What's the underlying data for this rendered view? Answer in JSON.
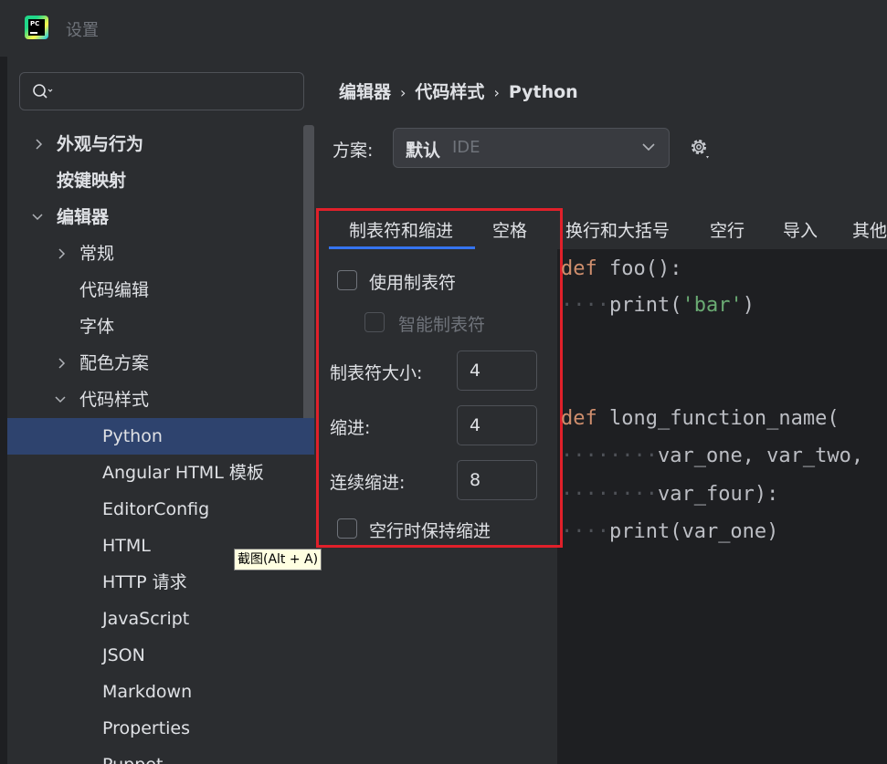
{
  "window": {
    "title": "设置"
  },
  "search": {
    "placeholder": "",
    "icon": "search-icon"
  },
  "sidebar": {
    "items": [
      {
        "label": "外观与行为",
        "expandable": true,
        "expanded": false,
        "bold": true
      },
      {
        "label": "按键映射",
        "expandable": false,
        "bold": true
      },
      {
        "label": "编辑器",
        "expandable": true,
        "expanded": true,
        "bold": true
      },
      {
        "label": "常规",
        "expandable": true,
        "expanded": false
      },
      {
        "label": "代码编辑",
        "expandable": false
      },
      {
        "label": "字体",
        "expandable": false
      },
      {
        "label": "配色方案",
        "expandable": true,
        "expanded": false
      },
      {
        "label": "代码样式",
        "expandable": true,
        "expanded": true
      },
      {
        "label": "Python",
        "selected": true
      },
      {
        "label": "Angular HTML 模板"
      },
      {
        "label": "EditorConfig"
      },
      {
        "label": "HTML"
      },
      {
        "label": "HTTP 请求"
      },
      {
        "label": "JavaScript"
      },
      {
        "label": "JSON"
      },
      {
        "label": "Markdown"
      },
      {
        "label": "Properties"
      },
      {
        "label": "Puppet"
      }
    ]
  },
  "breadcrumb": [
    "编辑器",
    "代码样式",
    "Python"
  ],
  "scheme": {
    "label": "方案:",
    "value": "默认",
    "sub": "IDE"
  },
  "tabs": [
    {
      "label": "制表符和缩进",
      "active": true
    },
    {
      "label": "空格"
    },
    {
      "label": "换行和大括号"
    },
    {
      "label": "空行"
    },
    {
      "label": "导入"
    },
    {
      "label": "其他"
    }
  ],
  "options": {
    "use_tab": {
      "label": "使用制表符",
      "checked": false
    },
    "smart_tab": {
      "label": "智能制表符",
      "checked": false,
      "disabled": true
    },
    "tab_size": {
      "label": "制表符大小:",
      "value": "4"
    },
    "indent": {
      "label": "缩进:",
      "value": "4"
    },
    "continuation_indent": {
      "label": "连续缩进:",
      "value": "8"
    },
    "keep_indent_blank": {
      "label": "空行时保持缩进",
      "checked": false
    }
  },
  "code": {
    "l1_kw": "def",
    "l1_rest": " foo():",
    "l2_dots": "····",
    "l2_fn": "print(",
    "l2_str": "'bar'",
    "l2_end": ")",
    "l3_kw": "def",
    "l3_rest": " long_function_name(",
    "l4_dots": "········",
    "l4_rest": "var_one, var_two,",
    "l5_dots": "········",
    "l5_rest": "var_four):",
    "l6_dots": "····",
    "l6_rest": "print(var_one)"
  },
  "tooltip": "截图(Alt + A)",
  "colors": {
    "accent": "#3574f0",
    "selection": "#2e436e",
    "highlight_box": "#e0202a",
    "keyword": "#cf8e6d",
    "string": "#6aab73"
  }
}
